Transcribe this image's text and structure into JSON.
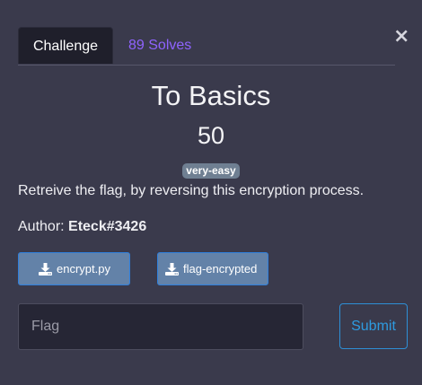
{
  "modal": {
    "close_label": "×"
  },
  "tabs": [
    {
      "label": "Challenge",
      "active": true
    },
    {
      "label": "89 Solves",
      "active": false
    }
  ],
  "challenge": {
    "title": "To Basics",
    "points": "50",
    "difficulty": "very-easy",
    "description": "Retreive the flag, by reversing this encryption process.",
    "author_label": "Author: ",
    "author_name": "Eteck#3426"
  },
  "files": [
    {
      "label": "encrypt.py",
      "icon": "download-icon"
    },
    {
      "label": "flag-encrypted",
      "icon": "download-icon"
    }
  ],
  "flag_form": {
    "placeholder": "Flag",
    "value": "",
    "submit_label": "Submit"
  },
  "colors": {
    "background": "#3a3a4c",
    "active_tab": "#1f1f2b",
    "solves_link": "#8f63ff",
    "badge": "#6f7f92",
    "file_button": "#6382a8",
    "submit_accent": "#2e9be0"
  }
}
